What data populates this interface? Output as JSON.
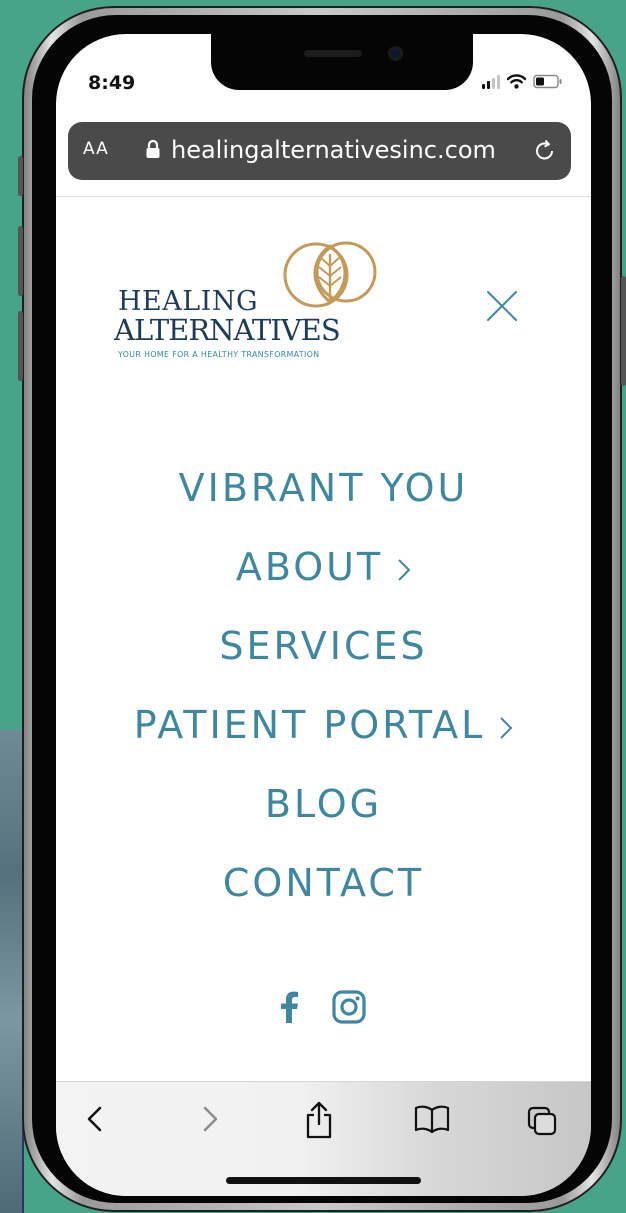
{
  "status_bar": {
    "time": "8:49"
  },
  "browser": {
    "text_size_label": "AA",
    "url": "healingalternativesinc.com"
  },
  "logo": {
    "line1": "HEALING",
    "line2": "ALTERNATIVES",
    "tagline": "YOUR HOME FOR A HEALTHY TRANSFORMATION"
  },
  "menu": {
    "items": [
      {
        "label": "VIBRANT YOU",
        "has_submenu": false
      },
      {
        "label": "ABOUT",
        "has_submenu": true
      },
      {
        "label": "SERVICES",
        "has_submenu": false
      },
      {
        "label": "PATIENT PORTAL",
        "has_submenu": true
      },
      {
        "label": "BLOG",
        "has_submenu": false
      },
      {
        "label": "CONTACT",
        "has_submenu": false
      }
    ]
  },
  "social": [
    "facebook-icon",
    "instagram-icon"
  ],
  "toolbar": [
    "back-icon",
    "forward-icon",
    "share-icon",
    "bookmarks-icon",
    "tabs-icon"
  ],
  "colors": {
    "background": "#48a489",
    "menu_text": "#3f87a0",
    "logo_text": "#1f3b57",
    "logo_gold": "#c49a5a",
    "url_bar": "#4a4a4a"
  }
}
